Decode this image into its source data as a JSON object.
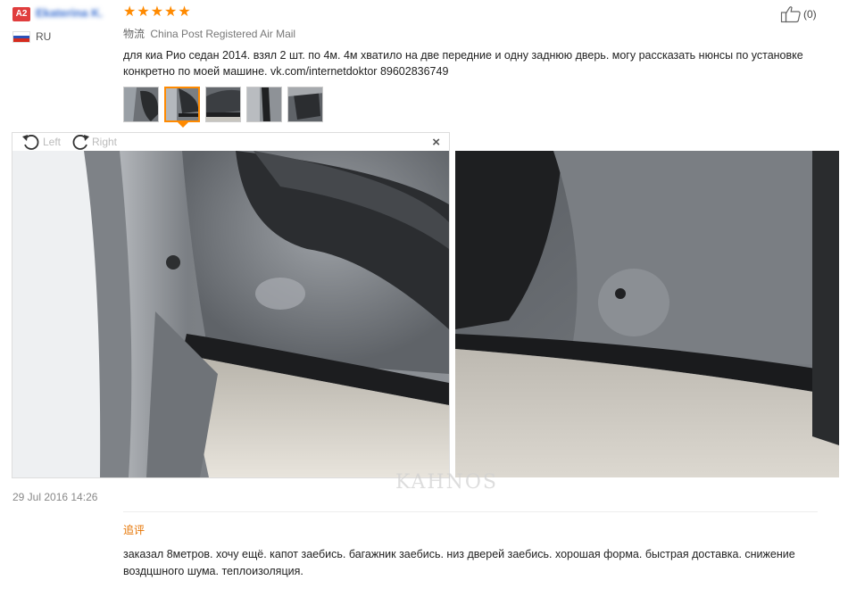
{
  "reviewer": {
    "level_badge": "A2",
    "name": "Ekaterina K.",
    "country": "RU",
    "flag_colors": [
      "#ffffff",
      "#2c51b8",
      "#d52b1e"
    ]
  },
  "rating": {
    "stars": 5,
    "star_glyph": "★",
    "color": "#ff8a00"
  },
  "helpful": {
    "icon": "thumbs-up-icon",
    "count": "(0)"
  },
  "shipping": {
    "label": "物流",
    "value": "China Post Registered Air Mail"
  },
  "review": {
    "text": "для киа Рио седан 2014. взял 2 шт. по 4м. 4м хватило на две передние и одну заднюю дверь. могу рассказать нюнсы по установке конкретно по моей машине. vk.com/internetdoktor 89602836749"
  },
  "thumbnails": [
    {
      "icon": "photo-thumbnail",
      "active": false
    },
    {
      "icon": "photo-thumbnail",
      "active": true
    },
    {
      "icon": "photo-thumbnail",
      "active": false
    },
    {
      "icon": "photo-thumbnail",
      "active": false
    },
    {
      "icon": "photo-thumbnail",
      "active": false
    }
  ],
  "viewer": {
    "rotate_left_label": "Left",
    "rotate_right_label": "Right",
    "close_glyph": "×"
  },
  "watermark": "KAHNOS",
  "date": "29 Jul 2016 14:26",
  "followup": {
    "label": "追评",
    "text": "заказал 8метров. хочу ещё. капот заебись. багажник заебись. низ дверей заебись. хорошая форма. быстрая доставка. снижение воздцшного шума. теплоизоляция."
  }
}
